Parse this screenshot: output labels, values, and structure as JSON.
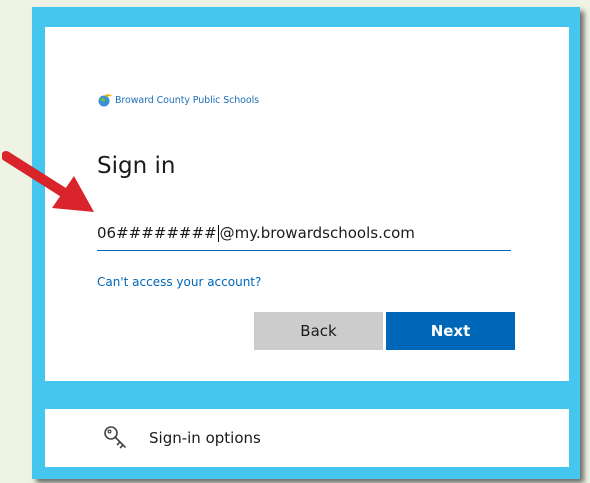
{
  "logo": {
    "text": "Broward County Public Schools",
    "icon": "globe-icon"
  },
  "signin": {
    "title": "Sign in",
    "email_value_left": "06########",
    "email_value_right": "@my.browardschools.com",
    "cant_access": "Can't access your account?",
    "back_label": "Back",
    "next_label": "Next"
  },
  "options": {
    "label": "Sign-in options",
    "icon": "key-icon"
  },
  "colors": {
    "frame": "#44c6ee",
    "accent": "#0067b8",
    "back_button": "#cccccc",
    "arrow": "#d9242b"
  }
}
